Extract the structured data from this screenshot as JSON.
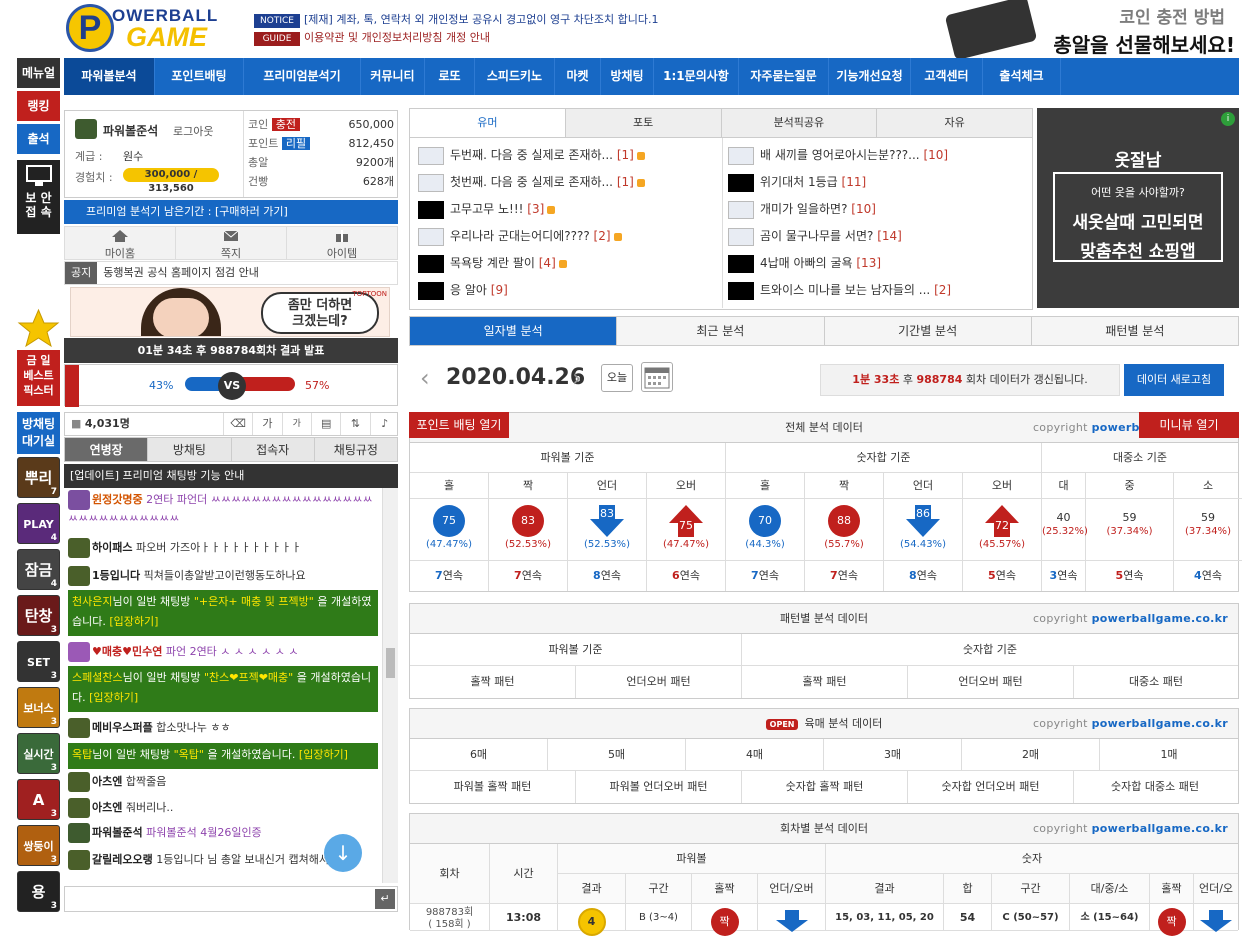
{
  "header": {
    "logo_top": "OWERBALL",
    "logo_bottom": "GAME",
    "logo_letter": "P",
    "notice_tag": "NOTICE",
    "notice_text": "[제재] 계좌, 톡, 연락처 외 개인정보 공유시 경고없이 영구 차단조치 합니다.1",
    "guide_tag": "GUIDE",
    "guide_text": "이용약관 및 개인정보처리방침 개정 안내",
    "banner_line1": "코인 충전 방법",
    "banner_line2": "총알을 선물해보세요!"
  },
  "left_menu": [
    "메뉴얼",
    "랭킹",
    "출석"
  ],
  "secure_label": "보 안\n접 속",
  "nav": [
    "파워볼분석",
    "포인트배팅",
    "프리미엄분석기",
    "커뮤니티",
    "로또",
    "스피드키노",
    "마켓",
    "방채팅",
    "1:1문의사항",
    "자주묻는질문",
    "기능개선요청",
    "고객센터",
    "출석체크"
  ],
  "profile": {
    "name": "파워볼준석",
    "logout": "로그아웃",
    "level_label": "계급 :",
    "level": "원수",
    "exp_label": "경험치 :",
    "exp": "300,000 / 313,560",
    "coin_label": "코인",
    "charge": "충전",
    "coin": "650,000",
    "point_label": "포인트",
    "refill": "리필",
    "point": "812,450",
    "ammo_label": "총알",
    "ammo": "9200개",
    "ticket_label": "건빵",
    "ticket": "628개"
  },
  "premium": "프리미엄 분석기 남은기간 : [구매하러 가기]",
  "quick": [
    "마이홈",
    "쪽지",
    "아이템"
  ],
  "gongji": {
    "tag": "공지",
    "text": "동행복권 공식 홈페이지 점검 안내"
  },
  "toon_text": "좀만 더하면\n크겠는데?",
  "toon_brand": "TOPTOON",
  "result": "01분 34초 후 988784회차 결과 발표",
  "vs": {
    "left": "43%",
    "right": "57%",
    "label": "VS"
  },
  "weekend_best": "금 일\n베스트\n픽스터",
  "room_wait": "방채팅\n대기실",
  "game_icons": [
    {
      "label": "뿌리",
      "n": "7"
    },
    {
      "label": "PLAY",
      "n": "4"
    },
    {
      "label": "잠금",
      "n": "4"
    },
    {
      "label": "탄창",
      "n": "3"
    },
    {
      "label": "SET",
      "n": "3"
    },
    {
      "label": "보너스",
      "n": "3"
    },
    {
      "label": "실시간",
      "n": "3"
    },
    {
      "label": "A",
      "n": "3"
    },
    {
      "label": "쌍둥이",
      "n": "3"
    },
    {
      "label": "용",
      "n": "3"
    }
  ],
  "chat": {
    "count": "4,031명",
    "tabs": [
      "연병장",
      "방채팅",
      "접속자",
      "채팅규정"
    ],
    "notice": "[업데이트] 프리미엄 채팅방 기능 안내",
    "messages": [
      {
        "nick": "윈정갓명중",
        "text": "2연타 파언더 ㅆㅆㅆㅆㅆㅆㅆㅆㅆㅆㅆㅆㅆㅆㅆㅆㅆㅆㅆㅆㅆㅆㅆㅆㅆㅆㅆ"
      },
      {
        "nick": "하이패스",
        "text": "파오버 가즈아ㅏㅏㅏㅏㅏㅏㅏㅏㅏㅏ"
      },
      {
        "nick": "1등입니다",
        "text": "픽쳐들이총알받고이런행동도하나요"
      },
      {
        "nick": "♥매충♥민수연",
        "text": "파언 2연타 ㅅ ㅅ ㅅ ㅅ ㅅ ㅅ"
      },
      {
        "nick": "메비우스퍼플",
        "text": "합소맛나누 ㅎㅎ"
      },
      {
        "nick": "아츠엔",
        "text": "합짝줄음"
      },
      {
        "nick": "아츠엔",
        "text": "줘버리나.."
      },
      {
        "nick": "파워볼준석",
        "text": "파워볼준석 4월26일인증"
      },
      {
        "nick": "갈릴레오오랭",
        "text": "1등입니다 님 총알 보내신거 캡쳐해서"
      }
    ],
    "sys1_a": "천사은지",
    "sys1_b": "님이 일반 채팅방 ",
    "sys1_c": "\"+은자+ 매충 및 프젝방\"",
    "sys1_d": " 을 개설하였습니다. ",
    "sys1_e": "[입장하기]",
    "sys2_a": "스페셜찬스",
    "sys2_b": "님이 일반 채팅방 ",
    "sys2_c": "\"찬스❤프젝❤매충\"",
    "sys2_d": " 을 개설하였습니다. ",
    "sys2_e": "[입장하기]",
    "sys3_a": "옥탑",
    "sys3_b": "님이 일반 채팅방 ",
    "sys3_c": "\"옥탑\"",
    "sys3_d": " 을 개설하였습니다. ",
    "sys3_e": "[입장하기]"
  },
  "board": {
    "tabs": [
      "유머",
      "포토",
      "분석픽공유",
      "자유"
    ],
    "left": [
      {
        "t": "두번째. 다음 중 실제로 존재하...",
        "c": "[1]",
        "fire": false
      },
      {
        "t": "첫번째. 다음 중 실제로 존재하...",
        "c": "[1]",
        "fire": false
      },
      {
        "t": "고무고무 노!!!",
        "c": "[3]",
        "fire": true
      },
      {
        "t": "우리나라 군대는어디에????",
        "c": "[2]",
        "fire": false
      },
      {
        "t": "목욕탕 계란 팔이",
        "c": "[4]",
        "fire": true
      },
      {
        "t": "응 알아",
        "c": "[9]",
        "fire": true
      }
    ],
    "right": [
      {
        "t": "배 새끼를 영어로아시는분???...",
        "c": "[10]",
        "fire": false
      },
      {
        "t": "위기대처 1등급",
        "c": "[11]",
        "fire": true
      },
      {
        "t": "개미가 일을하면?",
        "c": "[10]",
        "fire": false
      },
      {
        "t": "곰이 물구나무를 서면?",
        "c": "[14]",
        "fire": false
      },
      {
        "t": "4납매 아빠의 굴욕",
        "c": "[13]",
        "fire": true
      },
      {
        "t": "트와이스 미나를 보는 남자들의 ...",
        "c": "[2]",
        "fire": true
      }
    ]
  },
  "ad": {
    "brand": "옷잘남",
    "q": "어떤 옷을 사야할까?",
    "l1": "새옷살때 고민되면",
    "l2": "맞춤추천 쇼핑앱"
  },
  "analysis_tabs": [
    "일자별 분석",
    "최근 분석",
    "기간별 분석",
    "패턴별 분석"
  ],
  "date": "2020.04.26",
  "today": "오늘",
  "refresh_info": {
    "time": "1분 33초",
    "mid": " 후 ",
    "round": "988784",
    "tail": " 회차 데이터가 갱신됩니다."
  },
  "refresh_btn": "데이터 새로고침",
  "total": {
    "title": "전체 분석 데이터",
    "point_btn": "포인트 배팅 열기",
    "menu_btn": "미니뷰 열기",
    "copyright": "copyright ",
    "site": "powerballgame.co.kr",
    "groups": [
      "파워볼 기준",
      "숫자합 기준",
      "대중소 기준"
    ],
    "cols": [
      "홀",
      "짝",
      "언더",
      "오버",
      "홀",
      "짝",
      "언더",
      "오버",
      "대",
      "중",
      "소"
    ],
    "vals": [
      "75",
      "83",
      "83",
      "75",
      "70",
      "88",
      "86",
      "72",
      "40",
      "59",
      "59"
    ],
    "pcts": [
      "(47.47%)",
      "(52.53%)",
      "(52.53%)",
      "(47.47%)",
      "(44.3%)",
      "(55.7%)",
      "(54.43%)",
      "(45.57%)",
      "(25.32%)",
      "(37.34%)",
      "(37.34%)"
    ],
    "streak": [
      "7",
      "7",
      "8",
      "6",
      "7",
      "7",
      "8",
      "5",
      "3",
      "5",
      "4"
    ],
    "streak_unit": "연속"
  },
  "pattern": {
    "title": "패턴별 분석 데이터",
    "g1": "파워볼 기준",
    "g2": "숫자합 기준",
    "cells": [
      "홀짝 패턴",
      "언더오버 패턴",
      "홀짝 패턴",
      "언더오버 패턴",
      "대중소 패턴"
    ]
  },
  "six": {
    "open": "OPEN",
    "title": "육매 분석 데이터",
    "cols": [
      "6매",
      "5매",
      "4매",
      "3매",
      "2매",
      "1매"
    ],
    "cells": [
      "파워볼 홀짝 패턴",
      "파워볼 언더오버 패턴",
      "숫자합 홀짝 패턴",
      "숫자합 언더오버 패턴",
      "숫자합 대중소 패턴"
    ]
  },
  "round": {
    "title": "회차별 분석 데이터",
    "h_round": "회차",
    "h_time": "시간",
    "h_pb": "파워볼",
    "h_sum": "숫자",
    "sub": [
      "결과",
      "구간",
      "홀짝",
      "언더/오버",
      "결과",
      "합",
      "구간",
      "대/중/소",
      "홀짝",
      "언더/오버"
    ],
    "row": {
      "round": "988783회",
      "sub": "( 158회 )",
      "time": "13:08",
      "ball": "4",
      "pb_range": "B (3~4)",
      "pb_oe": "짝",
      "nums": "15, 03, 11, 05, 20",
      "sum": "54",
      "range": "C (50~57)",
      "size": "소 (15~64)",
      "oe": "짝"
    }
  },
  "colors": {
    "blue": "#1768c4",
    "red": "#c0201d",
    "dark": "#0b4a98"
  }
}
